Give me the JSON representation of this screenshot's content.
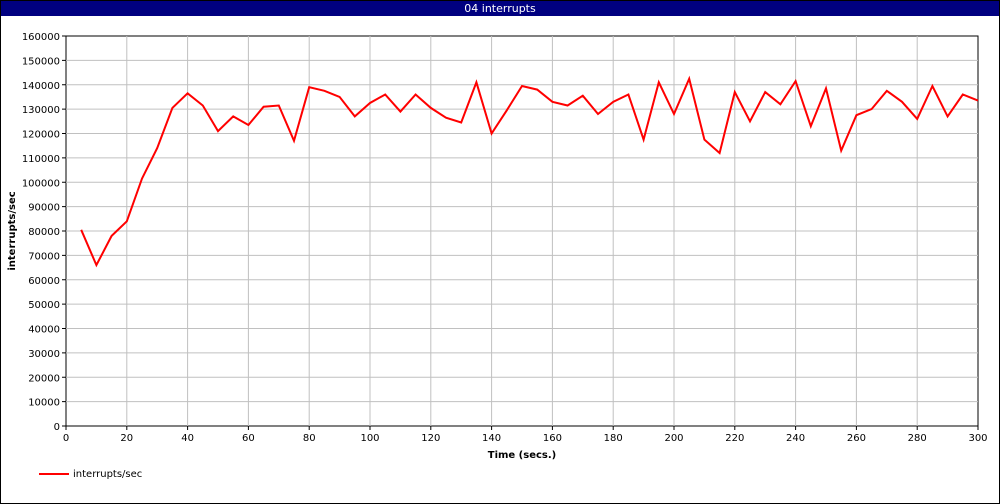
{
  "window": {
    "title": "04 interrupts"
  },
  "colors": {
    "series": "#ff0000",
    "titlebar": "#000080",
    "grid": "#c0c0c0"
  },
  "chart_data": {
    "type": "line",
    "xlabel": "Time (secs.)",
    "ylabel": "interrupts/sec",
    "xlim": [
      0,
      300
    ],
    "ylim": [
      0,
      160000
    ],
    "xticks": [
      0,
      20,
      40,
      60,
      80,
      100,
      120,
      140,
      160,
      180,
      200,
      220,
      240,
      260,
      280,
      300
    ],
    "yticks": [
      0,
      10000,
      20000,
      30000,
      40000,
      50000,
      60000,
      70000,
      80000,
      90000,
      100000,
      110000,
      120000,
      130000,
      140000,
      150000,
      160000
    ],
    "grid": true,
    "legend_position": "bottom-left",
    "series": [
      {
        "name": "interrupts/sec",
        "x": [
          5,
          10,
          15,
          20,
          25,
          30,
          35,
          40,
          45,
          50,
          55,
          60,
          65,
          70,
          75,
          80,
          85,
          90,
          95,
          100,
          105,
          110,
          115,
          120,
          125,
          130,
          135,
          140,
          145,
          150,
          155,
          160,
          165,
          170,
          175,
          180,
          185,
          190,
          195,
          200,
          205,
          210,
          215,
          220,
          225,
          230,
          235,
          240,
          245,
          250,
          255,
          260,
          265,
          270,
          275,
          280,
          285,
          290,
          295,
          300
        ],
        "y": [
          80500,
          66000,
          78000,
          84000,
          101500,
          114000,
          130500,
          136500,
          131500,
          121000,
          127000,
          123500,
          131000,
          131500,
          117000,
          139000,
          137500,
          135000,
          127000,
          132500,
          136000,
          129000,
          136000,
          130500,
          126500,
          124500,
          141000,
          120000,
          129500,
          139500,
          138000,
          133000,
          131500,
          135500,
          128000,
          133000,
          136000,
          117500,
          141000,
          128000,
          142500,
          117500,
          112000,
          137000,
          125000,
          137000,
          132000,
          141500,
          123000,
          138500,
          113000,
          127500,
          130000,
          137500,
          133000,
          126000,
          139500,
          127000,
          136000,
          133500
        ]
      }
    ]
  }
}
